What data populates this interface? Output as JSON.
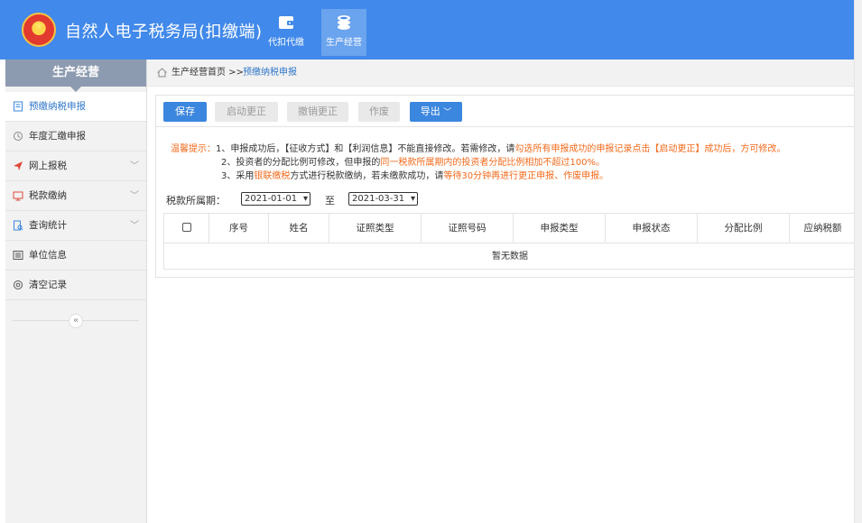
{
  "app": {
    "title": "自然人电子税务局(扣缴端)"
  },
  "topnav": [
    {
      "label": "代扣代缴",
      "icon": "wallet-icon"
    },
    {
      "label": "生产经营",
      "icon": "coins-icon"
    }
  ],
  "sidebar": {
    "header": "生产经营",
    "items": [
      {
        "label": "预缴纳税申报",
        "icon": "form-icon",
        "active": true
      },
      {
        "label": "年度汇缴申报",
        "icon": "annual-icon"
      },
      {
        "label": "网上报税",
        "icon": "send-icon",
        "expandable": true
      },
      {
        "label": "税款缴纳",
        "icon": "payment-icon",
        "expandable": true
      },
      {
        "label": "查询统计",
        "icon": "search-doc-icon",
        "expandable": true
      },
      {
        "label": "单位信息",
        "icon": "list-icon"
      },
      {
        "label": "清空记录",
        "icon": "clear-icon"
      }
    ],
    "collapse": "«"
  },
  "breadcrumb": {
    "home": "生产经营首页 >>",
    "current": "预缴纳税申报"
  },
  "toolbar": {
    "save": "保存",
    "start_correct": "启动更正",
    "cancel_correct": "撤销更正",
    "void": "作废",
    "export": "导出"
  },
  "tips": {
    "label": "温馨提示：",
    "line1_a": "1、申报成功后，【征收方式】和【利润信息】不能直接修改。若需修改，请",
    "line1_b": "勾选所有申报成功的申报记录点击【启动更正】成功后，方可修改。",
    "line2_a": "2、投资者的分配比例可修改，但申报的",
    "line2_b": "同一税款所属期内的投资者分配比例相加不超过100%。",
    "line3_a": "3、采用",
    "line3_b": "银联缴税",
    "line3_c": "方式进行税款缴纳，若未缴款成功，请",
    "line3_d": "等待30分钟再进行更正申报、作废申报。"
  },
  "period": {
    "label": "税款所属期：",
    "start": "2021-01-01",
    "sep": "至",
    "end": "2021-03-31"
  },
  "table": {
    "columns": [
      "序号",
      "姓名",
      "证照类型",
      "证照号码",
      "申报类型",
      "申报状态",
      "分配比例",
      "应纳税额"
    ],
    "empty": "暂无数据"
  },
  "colors": {
    "topbar": "#4189ea",
    "primary": "#3b86de",
    "highlight": "#f26a1b",
    "sidebar_header": "#8d9bb0"
  }
}
